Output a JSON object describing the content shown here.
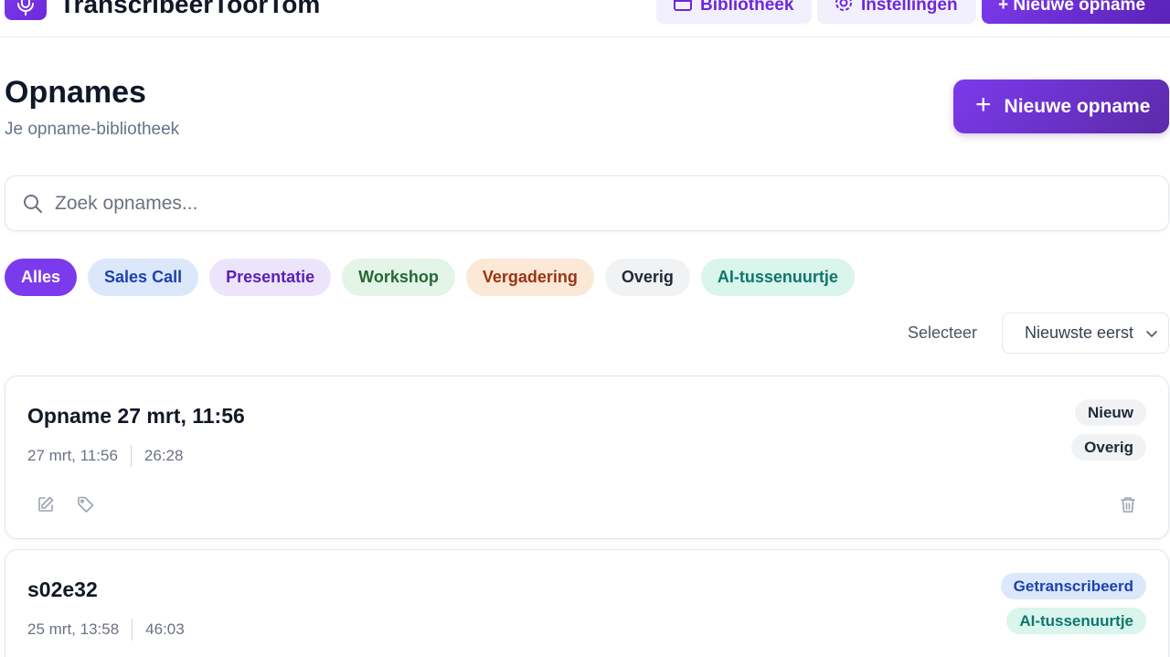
{
  "app": {
    "name": "TranscribeerToorTom"
  },
  "nav": {
    "library_label": "Bibliotheek",
    "settings_label": "Instellingen",
    "new_label": "+ Nieuwe opname"
  },
  "header": {
    "title": "Opnames",
    "subtitle": "Je opname-bibliotheek",
    "new_button_label": "Nieuwe opname"
  },
  "search": {
    "placeholder": "Zoek opnames...",
    "value": ""
  },
  "filters": [
    {
      "label": "Alles",
      "bg": "#7c3aed",
      "fg": "#ffffff",
      "active": true
    },
    {
      "label": "Sales Call",
      "bg": "#dbe8fb",
      "fg": "#1e40af"
    },
    {
      "label": "Presentatie",
      "bg": "#ece4fb",
      "fg": "#5b21b6"
    },
    {
      "label": "Workshop",
      "bg": "#e3f5e6",
      "fg": "#276738"
    },
    {
      "label": "Vergadering",
      "bg": "#fbe8d6",
      "fg": "#9a3412"
    },
    {
      "label": "Overig",
      "bg": "#f1f2f4",
      "fg": "#1f2937"
    },
    {
      "label": "AI-tussenuurtje",
      "bg": "#d9f5ec",
      "fg": "#0f766e"
    }
  ],
  "sort": {
    "label": "Selecteer",
    "selected": "Nieuwste eerst"
  },
  "recordings": [
    {
      "title": "Opname 27 mrt, 11:56",
      "date": "27 mrt, 11:56",
      "duration": "26:28",
      "badges": [
        {
          "label": "Nieuw",
          "bg": "#f1f2f4",
          "fg": "#1f2937"
        },
        {
          "label": "Overig",
          "bg": "#f1f2f4",
          "fg": "#1f2937"
        }
      ]
    },
    {
      "title": "s02e32",
      "date": "25 mrt, 13:58",
      "duration": "46:03",
      "badges": [
        {
          "label": "Getranscribeerd",
          "bg": "#dbe8fb",
          "fg": "#1e40af"
        },
        {
          "label": "AI-tussenuurtje",
          "bg": "#d9f5ec",
          "fg": "#0f766e"
        }
      ]
    }
  ],
  "icons": {
    "brand": "microphone-icon",
    "library": "archive-icon",
    "settings": "gear-icon",
    "search": "search-icon",
    "sort": "chevron-down-icon",
    "edit": "edit-icon",
    "tag": "tag-icon",
    "delete": "trash-icon"
  },
  "colors": {
    "accent": "#7c3aed",
    "accent_dark": "#5b21b6"
  }
}
